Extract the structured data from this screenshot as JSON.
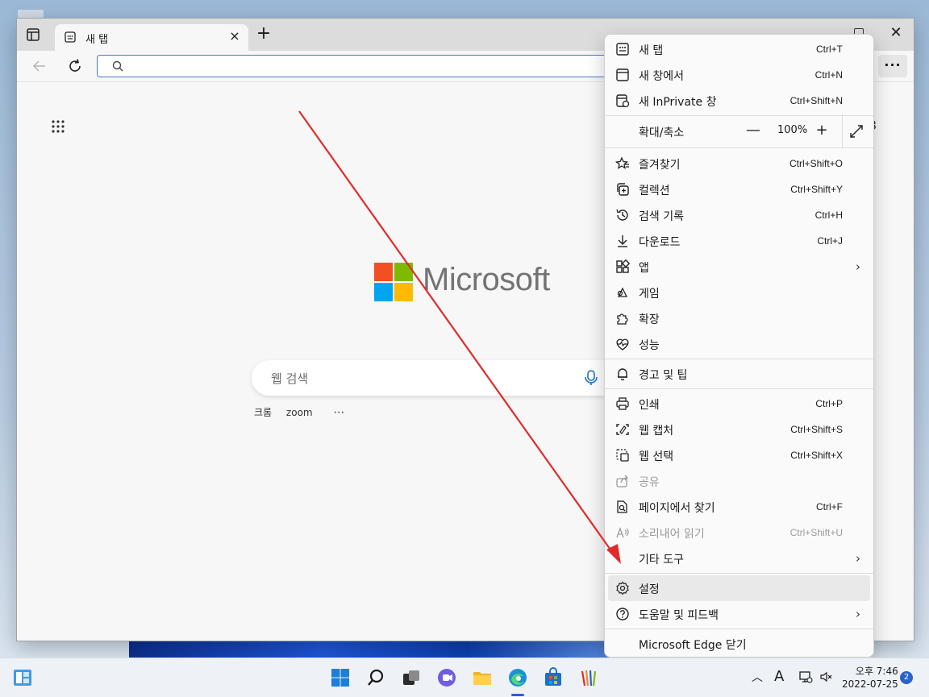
{
  "tab": {
    "title": "새 탭"
  },
  "search": {
    "placeholder": "웹 검색"
  },
  "brand": {
    "wordmark": "Microsoft"
  },
  "quick_links": [
    "크롬",
    "zoom",
    "⋯"
  ],
  "partial_edge_text": "3",
  "menu": {
    "items": [
      {
        "label": "새 탭",
        "shortcut": "Ctrl+T",
        "icon": "new-tab-icon"
      },
      {
        "label": "새 창에서",
        "shortcut": "Ctrl+N",
        "icon": "new-window-icon"
      },
      {
        "label": "새 InPrivate 창",
        "shortcut": "Ctrl+Shift+N",
        "icon": "inprivate-icon"
      },
      {
        "label": "즐겨찾기",
        "shortcut": "Ctrl+Shift+O",
        "icon": "favorites-icon"
      },
      {
        "label": "컬렉션",
        "shortcut": "Ctrl+Shift+Y",
        "icon": "collections-icon"
      },
      {
        "label": "검색 기록",
        "shortcut": "Ctrl+H",
        "icon": "history-icon"
      },
      {
        "label": "다운로드",
        "shortcut": "Ctrl+J",
        "icon": "download-icon"
      },
      {
        "label": "앱",
        "shortcut": "",
        "icon": "apps-icon"
      },
      {
        "label": "게임",
        "shortcut": "",
        "icon": "games-icon"
      },
      {
        "label": "확장",
        "shortcut": "",
        "icon": "extensions-icon"
      },
      {
        "label": "성능",
        "shortcut": "",
        "icon": "performance-icon"
      },
      {
        "label": "경고 및 팁",
        "shortcut": "",
        "icon": "bell-icon"
      },
      {
        "label": "인쇄",
        "shortcut": "Ctrl+P",
        "icon": "print-icon"
      },
      {
        "label": "웹 캡처",
        "shortcut": "Ctrl+Shift+S",
        "icon": "web-capture-icon"
      },
      {
        "label": "웹 선택",
        "shortcut": "Ctrl+Shift+X",
        "icon": "web-select-icon"
      },
      {
        "label": "공유",
        "shortcut": "",
        "icon": "share-icon"
      },
      {
        "label": "페이지에서 찾기",
        "shortcut": "Ctrl+F",
        "icon": "find-icon"
      },
      {
        "label": "소리내어 읽기",
        "shortcut": "Ctrl+Shift+U",
        "icon": "read-aloud-icon"
      },
      {
        "label": "기타 도구",
        "shortcut": "",
        "icon": ""
      },
      {
        "label": "설정",
        "shortcut": "",
        "icon": "gear-icon"
      },
      {
        "label": "도움말 및 피드백",
        "shortcut": "",
        "icon": "help-icon"
      },
      {
        "label": "Microsoft Edge 닫기",
        "shortcut": "",
        "icon": ""
      }
    ],
    "zoom": {
      "label": "확대/축소",
      "value": "100%",
      "minus": "—",
      "plus": "+"
    }
  },
  "taskbar": {
    "clock_period_time": "오후 7:46",
    "date": "2022-07-25",
    "notification_count": "2",
    "ime": "A"
  },
  "colors": {
    "accent": "#2a62c9",
    "arrow": "#e02b2b",
    "ms_red": "#f25022",
    "ms_green": "#7fba00",
    "ms_blue": "#00a4ef",
    "ms_yellow": "#ffb900"
  }
}
